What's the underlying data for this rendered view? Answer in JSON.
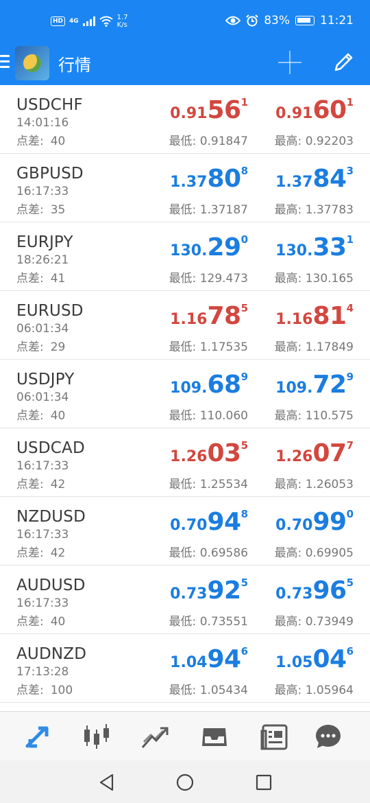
{
  "status_bar": {
    "hd": "HD",
    "network": "4G",
    "speed_value": "1.7",
    "speed_unit": "K/s",
    "battery": "83%",
    "time": "11:21"
  },
  "header": {
    "title": "行情"
  },
  "quotes": [
    {
      "symbol": "USDCHF",
      "time": "14:01:16",
      "spread_label": "点差:",
      "spread": "40",
      "color": "red",
      "bid": {
        "small": "0.91",
        "big": "56",
        "sup": "1"
      },
      "ask": {
        "small": "0.91",
        "big": "60",
        "sup": "1"
      },
      "low": "最低: 0.91847",
      "high": "最高: 0.92203"
    },
    {
      "symbol": "GBPUSD",
      "time": "16:17:33",
      "spread_label": "点差:",
      "spread": "35",
      "color": "blue",
      "bid": {
        "small": "1.37",
        "big": "80",
        "sup": "8"
      },
      "ask": {
        "small": "1.37",
        "big": "84",
        "sup": "3"
      },
      "low": "最低: 1.37187",
      "high": "最高: 1.37783"
    },
    {
      "symbol": "EURJPY",
      "time": "18:26:21",
      "spread_label": "点差:",
      "spread": "41",
      "color": "blue",
      "bid": {
        "small": "130.",
        "big": "29",
        "sup": "0"
      },
      "ask": {
        "small": "130.",
        "big": "33",
        "sup": "1"
      },
      "low": "最低: 129.473",
      "high": "最高: 130.165"
    },
    {
      "symbol": "EURUSD",
      "time": "06:01:34",
      "spread_label": "点差:",
      "spread": "29",
      "color": "red",
      "bid": {
        "small": "1.16",
        "big": "78",
        "sup": "5"
      },
      "ask": {
        "small": "1.16",
        "big": "81",
        "sup": "4"
      },
      "low": "最低: 1.17535",
      "high": "最高: 1.17849"
    },
    {
      "symbol": "USDJPY",
      "time": "06:01:34",
      "spread_label": "点差:",
      "spread": "40",
      "color": "blue",
      "bid": {
        "small": "109.",
        "big": "68",
        "sup": "9"
      },
      "ask": {
        "small": "109.",
        "big": "72",
        "sup": "9"
      },
      "low": "最低: 110.060",
      "high": "最高: 110.575"
    },
    {
      "symbol": "USDCAD",
      "time": "16:17:33",
      "spread_label": "点差:",
      "spread": "42",
      "color": "red",
      "bid": {
        "small": "1.26",
        "big": "03",
        "sup": "5"
      },
      "ask": {
        "small": "1.26",
        "big": "07",
        "sup": "7"
      },
      "low": "最低: 1.25534",
      "high": "最高: 1.26053"
    },
    {
      "symbol": "NZDUSD",
      "time": "16:17:33",
      "spread_label": "点差:",
      "spread": "42",
      "color": "blue",
      "bid": {
        "small": "0.70",
        "big": "94",
        "sup": "8"
      },
      "ask": {
        "small": "0.70",
        "big": "99",
        "sup": "0"
      },
      "low": "最低: 0.69586",
      "high": "最高: 0.69905"
    },
    {
      "symbol": "AUDUSD",
      "time": "16:17:33",
      "spread_label": "点差:",
      "spread": "40",
      "color": "blue",
      "bid": {
        "small": "0.73",
        "big": "92",
        "sup": "5"
      },
      "ask": {
        "small": "0.73",
        "big": "96",
        "sup": "5"
      },
      "low": "最低: 0.73551",
      "high": "最高: 0.73949"
    },
    {
      "symbol": "AUDNZD",
      "time": "17:13:28",
      "spread_label": "点差:",
      "spread": "100",
      "color": "blue",
      "bid": {
        "small": "1.04",
        "big": "94",
        "sup": "6"
      },
      "ask": {
        "small": "1.05",
        "big": "04",
        "sup": "6"
      },
      "low": "最低: 1.05434",
      "high": "最高: 1.05964"
    }
  ],
  "colors": {
    "brand_blue": "#1b86f3",
    "price_red": "#d2473f",
    "price_blue": "#1b7de0"
  },
  "tabs": [
    {
      "icon": "quotes-arrows-icon",
      "active": true
    },
    {
      "icon": "candlestick-chart-icon",
      "active": false
    },
    {
      "icon": "trade-trend-icon",
      "active": false
    },
    {
      "icon": "history-inbox-icon",
      "active": false
    },
    {
      "icon": "news-icon",
      "active": false
    },
    {
      "icon": "messages-icon",
      "active": false
    }
  ]
}
